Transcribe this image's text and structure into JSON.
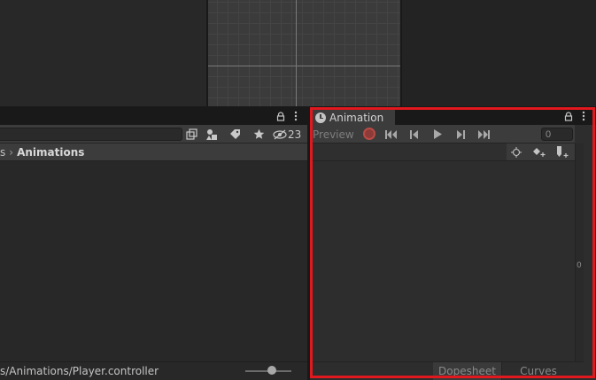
{
  "project": {
    "toolbar_count": "23",
    "breadcrumb": {
      "parent": "s",
      "current": "Animations"
    },
    "footer_path": "s/Animations/Player.controller",
    "search_value": "",
    "zoom_level": 0.58
  },
  "animation": {
    "tab_title": "Animation",
    "preview_label": "Preview",
    "frame_value": "0",
    "tabs": {
      "dopesheet": "Dopesheet",
      "curves": "Curves"
    },
    "right_marker": "0"
  },
  "colors": {
    "highlight": "#e1181d",
    "record": "#b94a45",
    "tab_accent": "#3a79bb"
  },
  "icons": [
    "lock-icon",
    "menu-icon",
    "search-filter-icon",
    "type-filter-icon",
    "label-tag-icon",
    "favorite-star-icon",
    "hidden-eye-icon",
    "record-icon",
    "first-key-icon",
    "prev-key-icon",
    "play-icon",
    "next-key-icon",
    "last-key-icon",
    "add-keyframe-icon",
    "add-event-icon",
    "filter-selected-icon"
  ]
}
